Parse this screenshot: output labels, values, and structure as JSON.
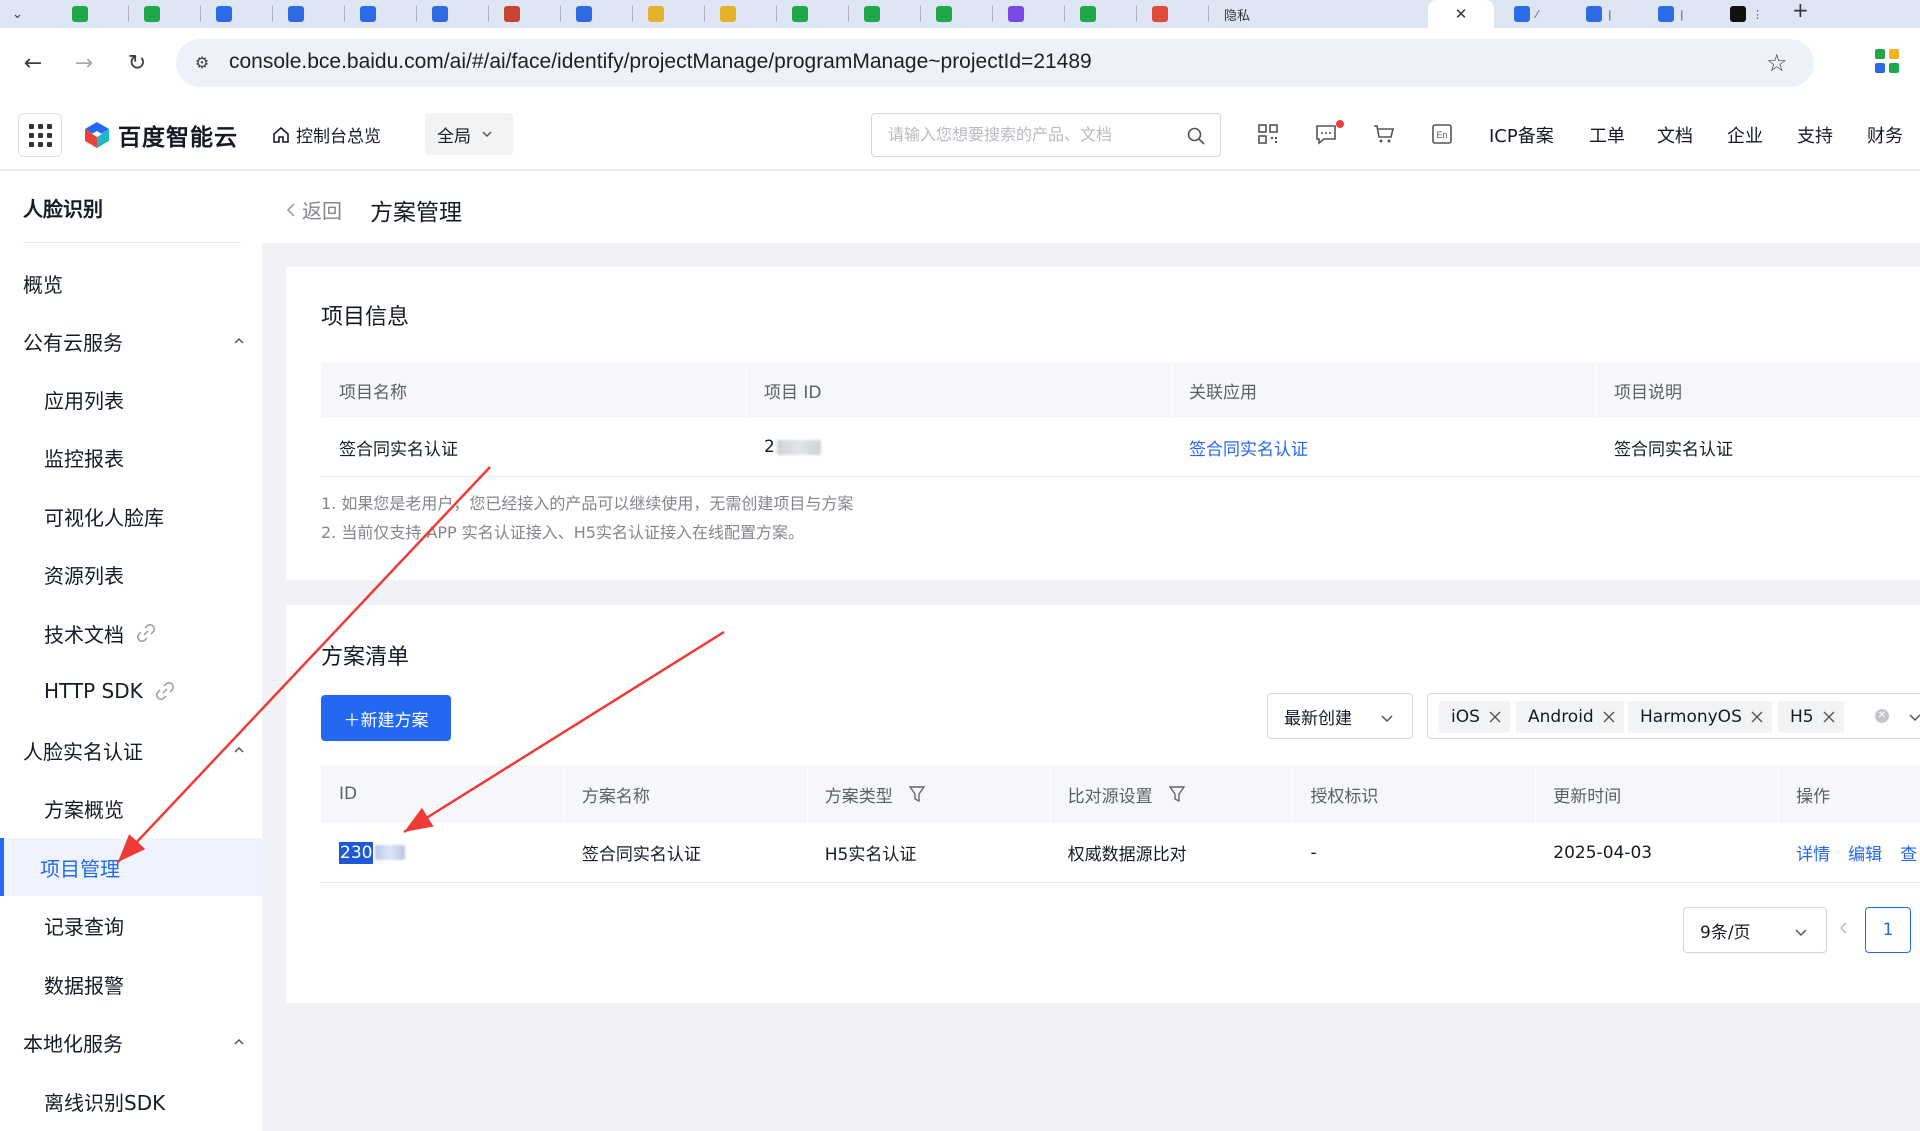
{
  "browser": {
    "tabs": [
      {
        "icon": "green-tab-icon",
        "color": "#1ea84a"
      },
      {
        "icon": "green-tab-icon",
        "color": "#1ea84a"
      },
      {
        "icon": "chart-tab-icon",
        "color": "#2d6ae3"
      },
      {
        "icon": "chart-tab-icon",
        "color": "#2d6ae3"
      },
      {
        "icon": "chart-tab-icon",
        "color": "#2d6ae3"
      },
      {
        "icon": "chart-tab-icon",
        "color": "#2d6ae3"
      },
      {
        "icon": "app-tab-icon",
        "color": "#c9432f"
      },
      {
        "icon": "chart-tab-icon",
        "color": "#2d6ae3"
      },
      {
        "icon": "pma-tab-icon",
        "color": "#e5b12a"
      },
      {
        "icon": "pma-tab-icon",
        "color": "#e5b12a"
      },
      {
        "icon": "green-tab-icon",
        "color": "#1ea84a"
      },
      {
        "icon": "green-tab-icon",
        "color": "#1ea84a"
      },
      {
        "icon": "green-tab-icon",
        "color": "#1ea84a"
      },
      {
        "icon": "purple-tab-icon",
        "color": "#7b48e8"
      },
      {
        "icon": "green-tab-icon",
        "color": "#1ea84a"
      },
      {
        "icon": "doc-tab-icon",
        "color": "#e04a3a"
      }
    ],
    "privacy_tab_label": "隐私",
    "url": "console.bce.baidu.com/ai/#/ai/face/identify/projectManage/programManage~projectId=21489"
  },
  "topbar": {
    "logo_text": "百度智能云",
    "home_label": "控制台总览",
    "region_label": "全局",
    "search_placeholder": "请输入您想要搜索的产品、文档",
    "links": [
      "ICP备案",
      "工单",
      "文档",
      "企业",
      "支持",
      "财务"
    ]
  },
  "sidebar": {
    "title": "人脸识别",
    "items": [
      {
        "label": "概览",
        "level": 1
      },
      {
        "label": "公有云服务",
        "level": 1,
        "expanded": true
      },
      {
        "label": "应用列表",
        "level": 2
      },
      {
        "label": "监控报表",
        "level": 2
      },
      {
        "label": "可视化人脸库",
        "level": 2
      },
      {
        "label": "资源列表",
        "level": 2
      },
      {
        "label": "技术文档",
        "level": 2,
        "external": true
      },
      {
        "label": "HTTP SDK",
        "level": 2,
        "external": true
      },
      {
        "label": "人脸实名认证",
        "level": 1,
        "expanded": true
      },
      {
        "label": "方案概览",
        "level": 2
      },
      {
        "label": "项目管理",
        "level": 2,
        "active": true
      },
      {
        "label": "记录查询",
        "level": 2
      },
      {
        "label": "数据报警",
        "level": 2
      },
      {
        "label": "本地化服务",
        "level": 1,
        "expanded": true
      },
      {
        "label": "离线识别SDK",
        "level": 2
      }
    ]
  },
  "page": {
    "back_label": "返回",
    "title": "方案管理"
  },
  "project_info": {
    "title": "项目信息",
    "columns": [
      "项目名称",
      "项目 ID",
      "关联应用",
      "项目说明"
    ],
    "row": {
      "name": "签合同实名认证",
      "id_visible": "2",
      "app": "签合同实名认证",
      "desc": "签合同实名认证"
    },
    "notes": [
      "1. 如果您是老用户，您已经接入的产品可以继续使用，无需创建项目与方案",
      "2. 当前仅支持 APP 实名认证接入、H5实名认证接入在线配置方案。"
    ]
  },
  "plans": {
    "title": "方案清单",
    "new_button": "＋新建方案",
    "sort_value": "最新创建",
    "platform_tags": [
      "iOS",
      "Android",
      "HarmonyOS",
      "H5"
    ],
    "columns": [
      "ID",
      "方案名称",
      "方案类型",
      "比对源设置",
      "授权标识",
      "更新时间",
      "操作"
    ],
    "rows": [
      {
        "id_visible": "230",
        "name": "签合同实名认证",
        "type": "H5实名认证",
        "source": "权威数据源比对",
        "auth": "-",
        "updated": "2025-04-03",
        "ops": [
          "详情",
          "编辑",
          "查"
        ]
      }
    ],
    "page_size": "9条/页",
    "current_page": "1"
  },
  "colors": {
    "primary": "#2468f2",
    "annotation_arrow": "#f03a35"
  }
}
